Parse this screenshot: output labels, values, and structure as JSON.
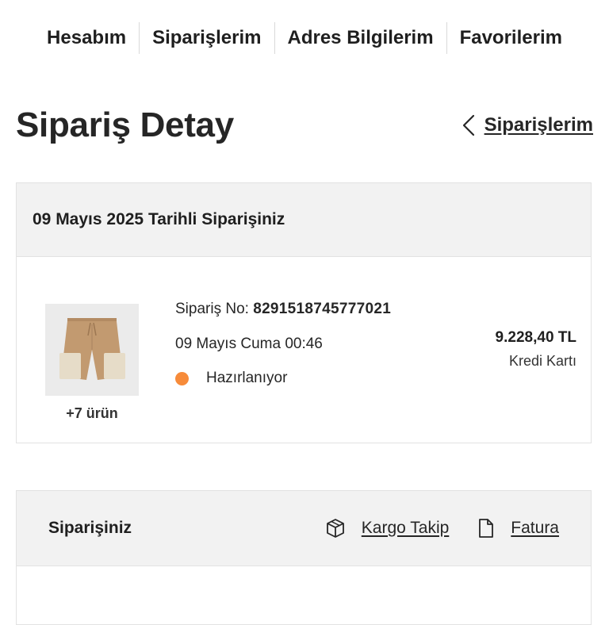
{
  "nav": {
    "items": [
      {
        "label": "Hesabım"
      },
      {
        "label": "Siparişlerim"
      },
      {
        "label": "Adres Bilgilerim"
      },
      {
        "label": "Favorilerim"
      }
    ]
  },
  "header": {
    "title": "Sipariş Detay",
    "back_label": "Siparişlerim",
    "back_icon": "chevron-left-icon"
  },
  "order": {
    "heading": "09 Mayıs 2025 Tarihli Siparişiniz",
    "order_no_label": "Sipariş No:",
    "order_no": "8291518745777021",
    "date": "09 Mayıs Cuma 00:46",
    "status": "Hazırlanıyor",
    "status_color": "#f78b3a",
    "more_items": "+7 ürün",
    "total": "9.228,40 TL",
    "payment_method": "Kredi Kartı",
    "product_image": "brown-shorts-with-beige-pockets"
  },
  "items_section": {
    "heading": "Siparişiniz",
    "cargo_label": "Kargo Takip",
    "cargo_icon": "box-icon",
    "invoice_label": "Fatura",
    "invoice_icon": "document-icon"
  }
}
